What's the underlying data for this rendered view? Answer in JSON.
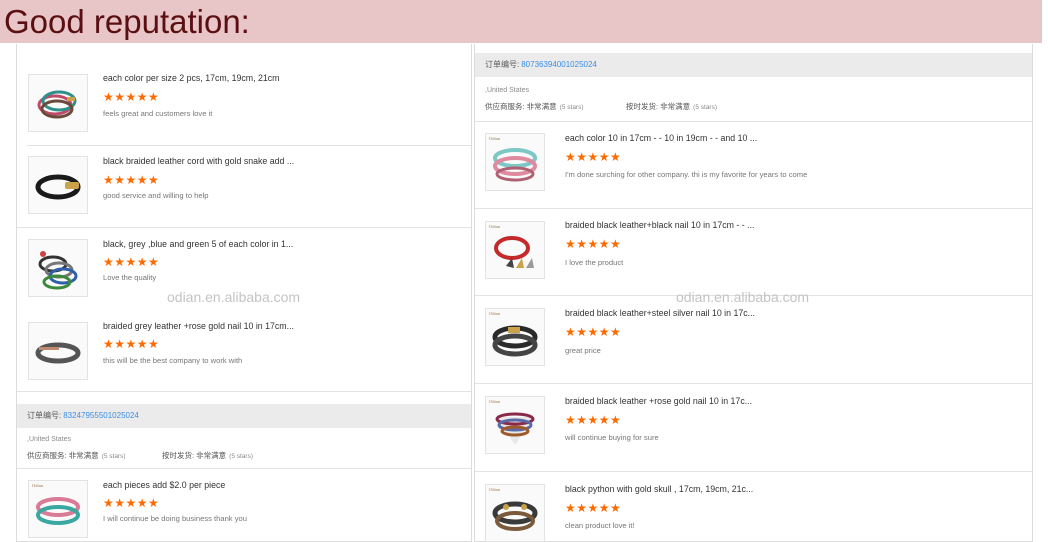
{
  "banner": {
    "title": "Good reputation:"
  },
  "watermarks": {
    "left": "odian.en.alibaba.com",
    "right": "odian.en.alibaba.com"
  },
  "left_panel": {
    "items": [
      {
        "title": "each color per size 2 pcs, 17cm, 19cm, 21cm",
        "stars": "★★★★★",
        "review": "feels great and customers love it"
      },
      {
        "title": "black braided leather cord with gold snake add ...",
        "stars": "★★★★★",
        "review": "good service and willing to help"
      },
      {
        "title": "black, grey ,blue and green 5 of each color in 1...",
        "stars": "★★★★★",
        "review": "Love the quality"
      },
      {
        "title": "braided grey leather +rose gold nail 10 in 17cm...",
        "stars": "★★★★★",
        "review": "this will be the best company to work with"
      }
    ],
    "order": {
      "label": "订单编号:",
      "number": "83247955501025024",
      "country": ",United States",
      "supplier_service": "供应商服务: 非常满意",
      "supplier_service_stars": "(5 stars)",
      "delivery": "按时发货: 非常满意",
      "delivery_stars": "(5 stars)",
      "items": [
        {
          "title": "each pieces add $2.0 per piece",
          "stars": "★★★★★",
          "review": "I will continue be doing business thank you"
        }
      ]
    }
  },
  "right_panel": {
    "order": {
      "label": "订单编号:",
      "number": "80736394001025024",
      "country": ",United States",
      "supplier_service": "供应商服务: 非常满意",
      "supplier_service_stars": "(5 stars)",
      "delivery": "按时发货: 非常满意",
      "delivery_stars": "(5 stars)",
      "items": [
        {
          "title": "each color 10 in 17cm - - 10 in 19cm - - and 10 ...",
          "stars": "★★★★★",
          "review": "I'm done surching for other company. thi is my favorite for years to come"
        },
        {
          "title": "braided black leather+black nail 10 in 17cm - - ...",
          "stars": "★★★★★",
          "review": "I love the product"
        },
        {
          "title": "braided black leather+steel silver nail 10 in 17c...",
          "stars": "★★★★★",
          "review": "great price"
        },
        {
          "title": "braided black leather +rose gold nail 10 in 17c...",
          "stars": "★★★★★",
          "review": "will continue buying for sure"
        },
        {
          "title": "black python with gold skull , 17cm, 19cm, 21c...",
          "stars": "★★★★★",
          "review": "clean product love it!"
        }
      ]
    }
  },
  "thumb_brand": "Odian"
}
